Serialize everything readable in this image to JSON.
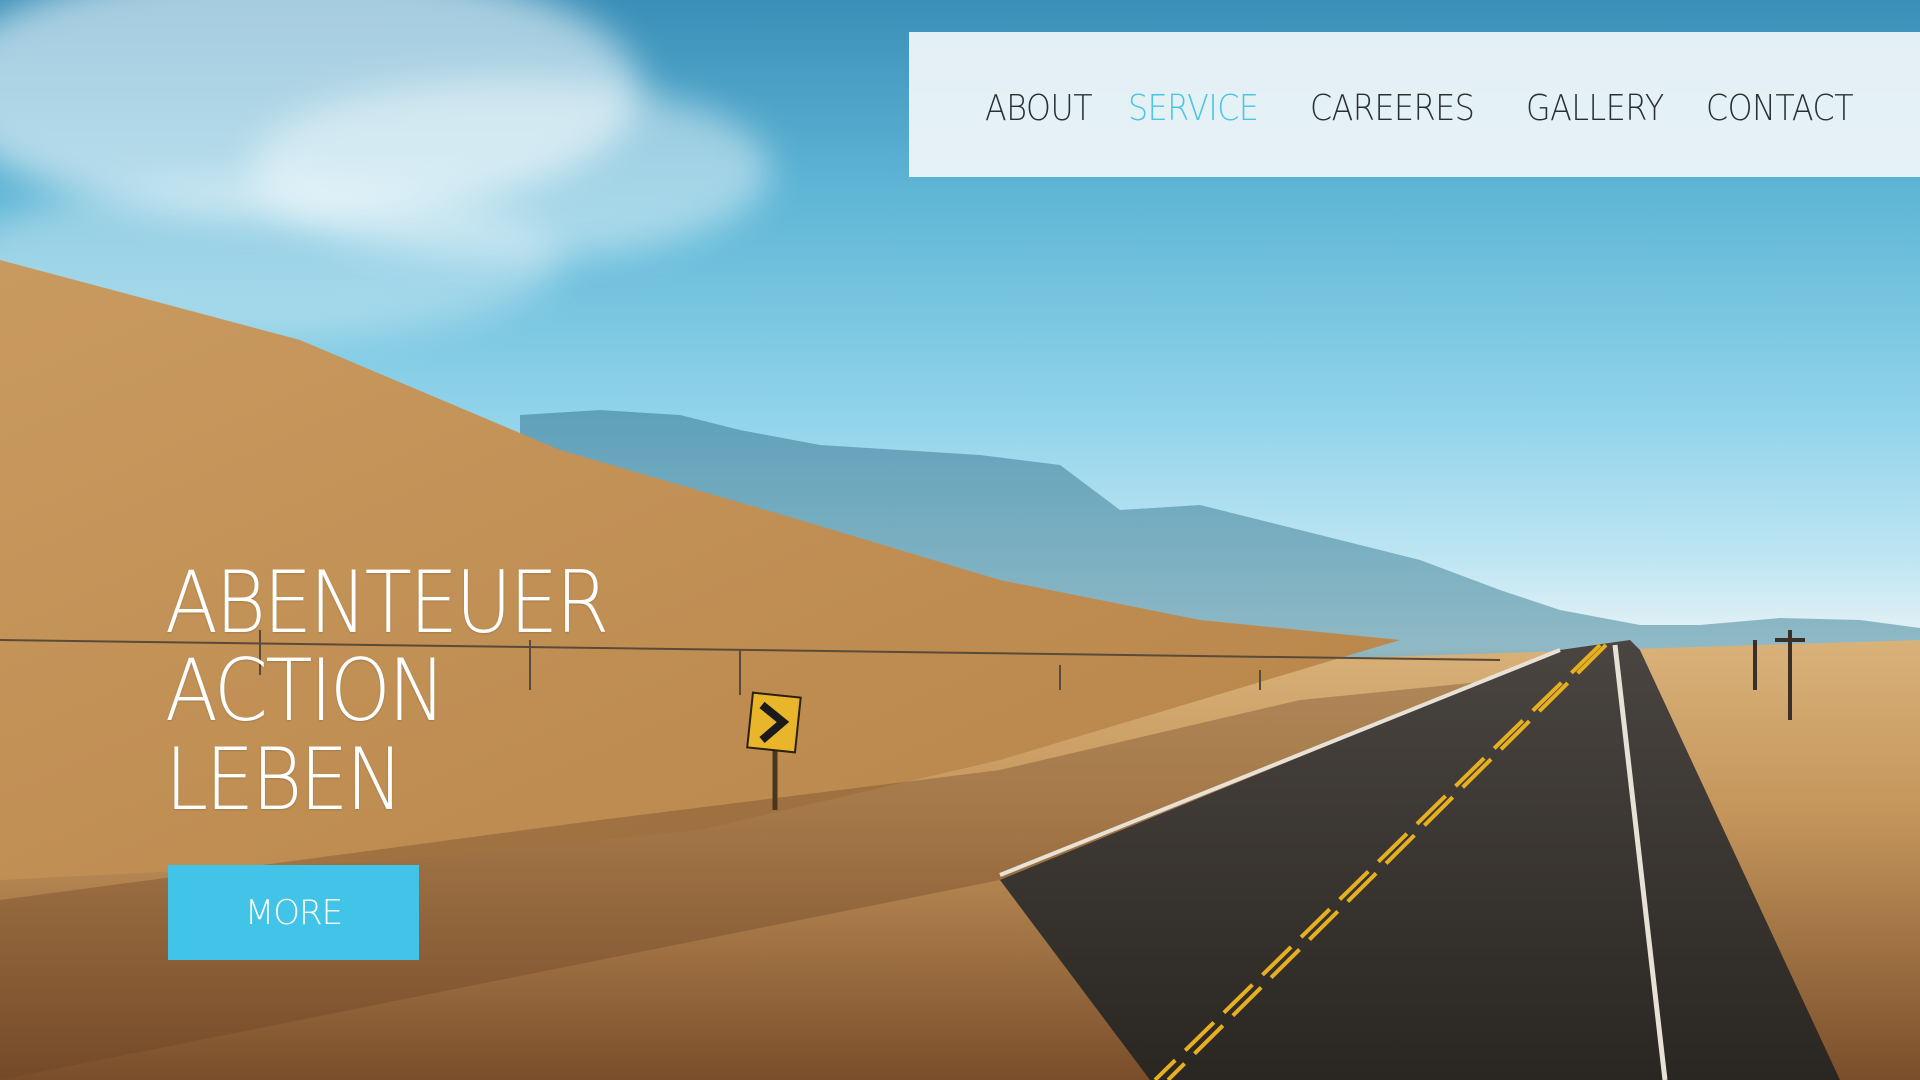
{
  "nav": {
    "items": [
      {
        "label": "ABOUT",
        "active": false
      },
      {
        "label": "SERVICE",
        "active": true
      },
      {
        "label": "CAREERES",
        "active": false
      },
      {
        "label": "GALLERY",
        "active": false
      },
      {
        "label": "CONTACT",
        "active": false
      }
    ]
  },
  "hero": {
    "lines": [
      "ABENTEUER",
      "ACTION",
      "LEBEN"
    ],
    "button_label": "MORE"
  },
  "colors": {
    "accent": "#42c3e8",
    "nav_text": "#2a2f33",
    "nav_active": "#4cc4e6",
    "nav_background": "#f0f6f9",
    "hero_text": "#ffffff"
  },
  "background": {
    "scene": "desert-highway-photo"
  }
}
